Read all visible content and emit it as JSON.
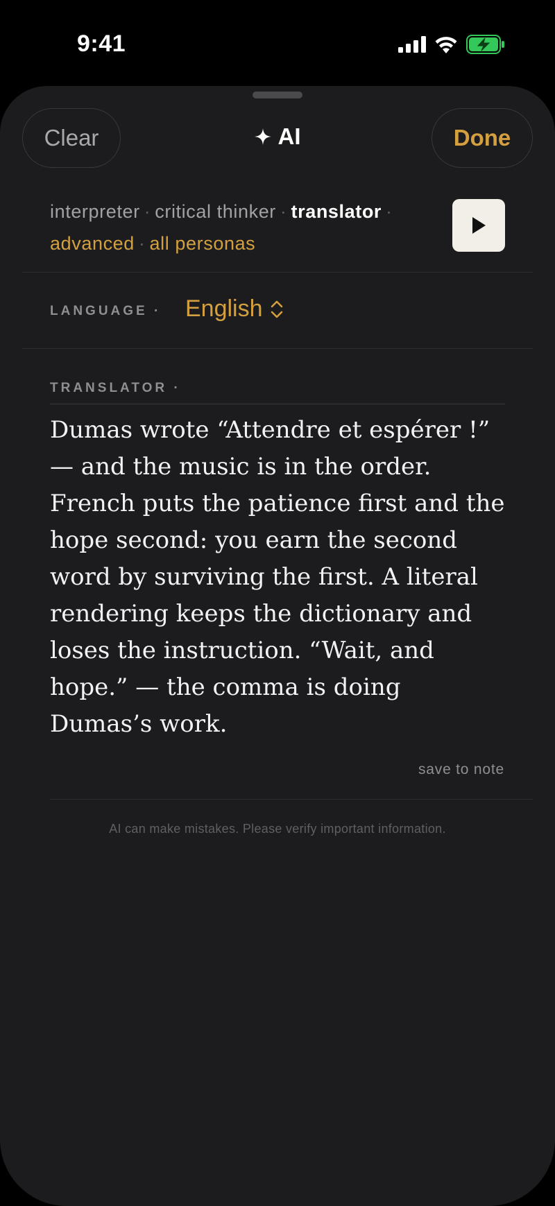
{
  "status_bar": {
    "time": "9:41",
    "icons": [
      "cellular-signal-icon",
      "wifi-icon",
      "battery-charging-icon"
    ],
    "battery_color": "#34c759"
  },
  "sheet": {
    "clear_label": "Clear",
    "done_label": "Done",
    "title_icon": "sparkle-icon",
    "title": "AI",
    "accent_color": "#d4a03f"
  },
  "personas": {
    "items": [
      "interpreter",
      "critical thinker",
      "translator"
    ],
    "active": "translator",
    "separator": "·",
    "advanced_label": "advanced",
    "all_personas_label": "all personas",
    "play_icon": "play-icon"
  },
  "language": {
    "label": "LANGUAGE ·",
    "value": "English",
    "chevron_icon": "up-down-chevron-icon"
  },
  "translator": {
    "label": "TRANSLATOR ·",
    "text": "Dumas wrote “Attendre et espérer !” — and the music is in the order. French puts the patience first and the hope second: you earn the second word by surviving the first. A literal rendering keeps the dictionary and loses the instruction. “Wait, and hope.” — the comma is doing Dumas’s work.",
    "save_label": "save to note"
  },
  "disclaimer": "AI can make mistakes. Please verify important information."
}
